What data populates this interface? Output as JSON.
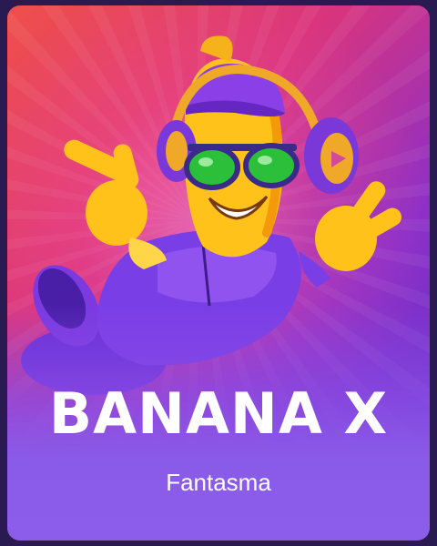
{
  "game": {
    "title": "BANANA X",
    "provider": "Fantasma"
  },
  "colors": {
    "frame": "#2a1a52",
    "bottom_panel": "#8c5cea",
    "text": "#ffffff"
  }
}
